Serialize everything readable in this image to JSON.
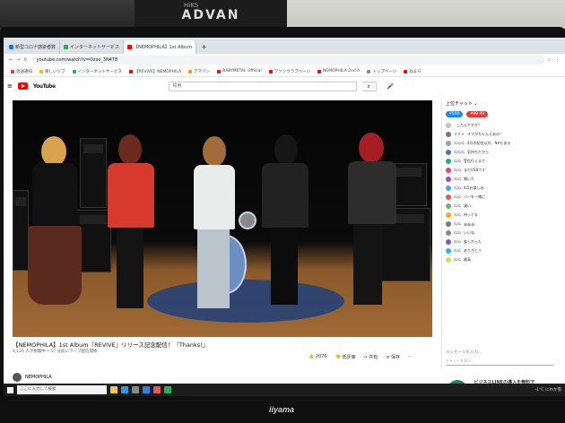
{
  "wall": {
    "banner": "ADVAN",
    "banner_sub": "HiKS"
  },
  "browser": {
    "tabs": [
      {
        "label": "新型コロナ感染者数",
        "color": "#1a73e8",
        "active": false
      },
      {
        "label": "インターネットサービス",
        "color": "#34a853",
        "active": false
      },
      {
        "label": "【NEMOPHILA】1st Album",
        "color": "#ff0000",
        "active": true
      }
    ],
    "newtab": "+",
    "url": "youtube.com/watch?v=Ozxo_3N4T8",
    "bookmarks": [
      "放送通知",
      "楽しいツブ",
      "インターネットサービス",
      "【REVIVE】NEMOPHILA",
      "アマゾン",
      "BABYMETAL Official",
      "ファンクラブページ",
      "NEMOPHILA 2nd A",
      "トップページ",
      "ねまら"
    ]
  },
  "youtube": {
    "logo": "YouTube",
    "search_placeholder": "検索",
    "video_title": "【NEMOPHILA】1st Album『REVIVE』リリース記念配信！『Thanks!』",
    "video_meta": "4,120 人が視聴中 • 57 分前にライブ配信開始",
    "likes": "2076",
    "dislike": "低評価",
    "share": "共有",
    "save": "保存",
    "channel": "NEMOPHILA",
    "taskbar_search": "ここに入力して検索",
    "tray_weather": "-1°C にわか雪"
  },
  "chat": {
    "header": "上位チャット",
    "chip1": "¥500",
    "chip2": "¥99.99",
    "chip1_color": "#1e88e5",
    "chip2_color": "#e53935",
    "messages": [
      {
        "name": "",
        "text": "したんですか？",
        "color": "#c0c0c0"
      },
      {
        "name": "ヌヌヌ",
        "text": "オフがちゃんとあの！",
        "color": "#8d6e63"
      },
      {
        "name": "ぬぬぬ",
        "text": "4月の配信以外、NHもある",
        "color": "#90a4ae"
      },
      {
        "name": "ぬぬぬ",
        "text": "気持ちだから",
        "color": "#5c6bc0"
      },
      {
        "name": "ぬぬ",
        "text": "受信行くまで",
        "color": "#26a69a"
      },
      {
        "name": "ぬぬ",
        "text": "まだUSBです",
        "color": "#ec407a"
      },
      {
        "name": "ぬぬ",
        "text": "開いた",
        "color": "#ab47bc"
      },
      {
        "name": "ぬぬ",
        "text": "4月お楽しみ",
        "color": "#42a5f5"
      },
      {
        "name": "ぬぬ",
        "text": "バーを一緒に",
        "color": "#ef5350"
      },
      {
        "name": "ぬぬ",
        "text": "凄い",
        "color": "#66bb6a"
      },
      {
        "name": "ぬぬ",
        "text": "待ってる",
        "color": "#ffa726"
      },
      {
        "name": "ぬぬ",
        "text": "😀😀😀",
        "color": "#8d6e63"
      },
      {
        "name": "ぬぬ",
        "text": "いいね",
        "color": "#78909c"
      },
      {
        "name": "ぬぬ",
        "text": "楽しかった",
        "color": "#7e57c2"
      },
      {
        "name": "ぬぬ",
        "text": "ありがとう",
        "color": "#29b6f6"
      },
      {
        "name": "ぬぬ",
        "text": "最高",
        "color": "#d4e157"
      }
    ],
    "input_label": "メッセージを入力...",
    "input_placeholder": "チャットを表示"
  },
  "ad": {
    "logo": "S",
    "title": "ビジネスLINEの導入を無料で",
    "text": "LINE WORKS 導入支援・トライアル 有料前提無料 • 導入事例多数"
  },
  "monitor": {
    "brand": "iiyama"
  }
}
